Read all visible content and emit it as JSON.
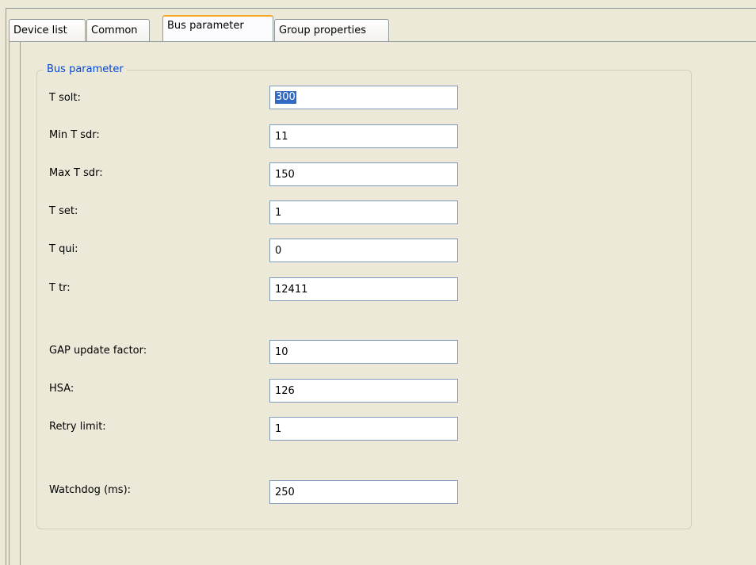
{
  "tabs": [
    {
      "label": "Device list",
      "active": false
    },
    {
      "label": "Common",
      "active": false
    },
    {
      "label": "Bus parameter",
      "active": true
    },
    {
      "label": "Group properties",
      "active": false
    }
  ],
  "group": {
    "title": "Bus parameter",
    "fields": [
      {
        "label": "T solt:",
        "value": "300",
        "selected": true
      },
      {
        "label": "Min T sdr:",
        "value": "11"
      },
      {
        "label": "Max T sdr:",
        "value": "150"
      },
      {
        "label": "T set:",
        "value": "1"
      },
      {
        "label": "T qui:",
        "value": "0"
      },
      {
        "label": "T tr:",
        "value": "12411"
      },
      {
        "label": "GAP update factor:",
        "value": "10"
      },
      {
        "label": "HSA:",
        "value": "126"
      },
      {
        "label": "Retry limit:",
        "value": "1"
      },
      {
        "label": "Watchdog (ms):",
        "value": "250"
      }
    ]
  },
  "colors": {
    "background": "#ece9d8",
    "group_title": "#0046d5",
    "active_tab_accent": "#f5a623",
    "selection": "#316ac5"
  }
}
